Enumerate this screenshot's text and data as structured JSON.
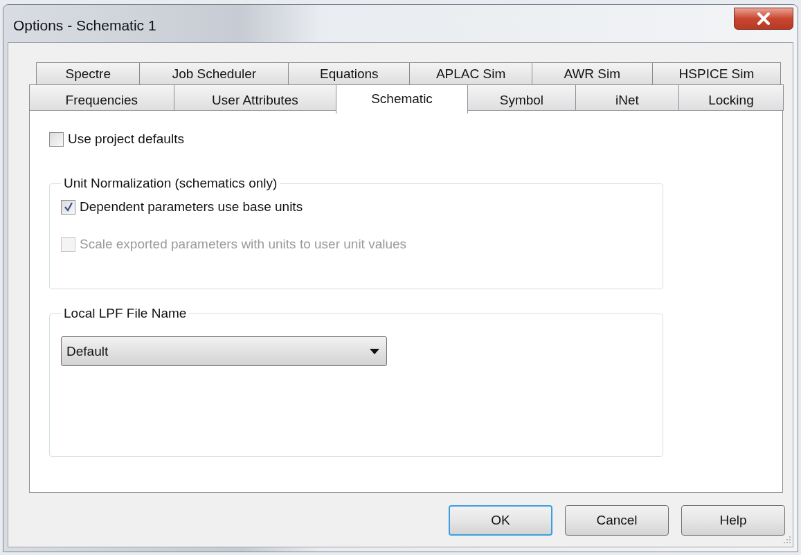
{
  "window": {
    "title": "Options - Schematic 1"
  },
  "tab_rows": [
    [
      {
        "label": "Spectre",
        "selected": false
      },
      {
        "label": "Job Scheduler",
        "selected": false
      },
      {
        "label": "Equations",
        "selected": false
      },
      {
        "label": "APLAC Sim",
        "selected": false
      },
      {
        "label": "AWR Sim",
        "selected": false
      },
      {
        "label": "HSPICE Sim",
        "selected": false
      }
    ],
    [
      {
        "label": "Frequencies",
        "selected": false
      },
      {
        "label": "User Attributes",
        "selected": false
      },
      {
        "label": "Schematic",
        "selected": true
      },
      {
        "label": "Symbol",
        "selected": false
      },
      {
        "label": "iNet",
        "selected": false
      },
      {
        "label": "Locking",
        "selected": false
      }
    ]
  ],
  "use_project_defaults": {
    "label": "Use project defaults",
    "checked": false,
    "disabled": false
  },
  "groups": [
    {
      "title": "Unit Normalization (schematics only)",
      "items": [
        {
          "kind": "checkbox",
          "label": "Dependent parameters use base units",
          "checked": true,
          "disabled": false
        },
        {
          "kind": "checkbox",
          "label": "Scale exported parameters with units to user unit values",
          "checked": false,
          "disabled": true
        }
      ]
    },
    {
      "title": "Local LPF File Name",
      "items": [
        {
          "kind": "dropdown",
          "value": "Default"
        }
      ]
    }
  ],
  "buttons": [
    {
      "label": "OK",
      "default": true
    },
    {
      "label": "Cancel",
      "default": false
    },
    {
      "label": "Help",
      "default": false
    }
  ]
}
